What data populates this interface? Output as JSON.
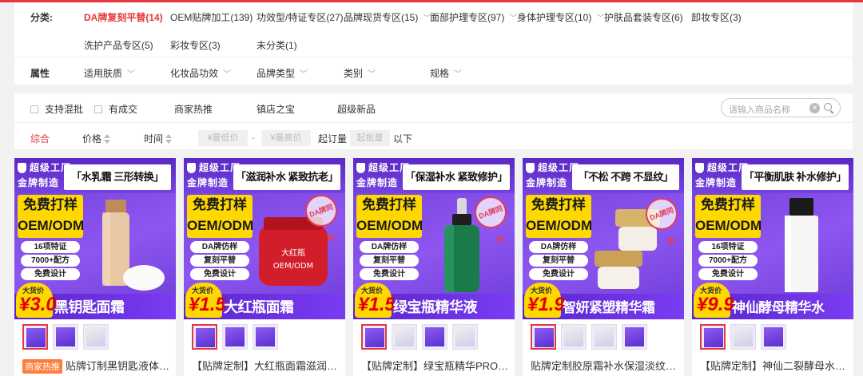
{
  "filters": {
    "category_label": "分类:",
    "categories": [
      {
        "label": "DA牌复刻平替(14)",
        "active": true
      },
      {
        "label": "OEM贴牌加工(139)"
      },
      {
        "label": "功效型/特证专区(27)"
      },
      {
        "label": "品牌现货专区(15)",
        "dropdown": true
      },
      {
        "label": "面部护理专区(97)",
        "dropdown": true
      },
      {
        "label": "身体护理专区(10)",
        "dropdown": true
      },
      {
        "label": "护肤品套装专区(6)"
      },
      {
        "label": "卸妆专区(3)"
      },
      {
        "label": "洗护产品专区(5)"
      },
      {
        "label": "彩妆专区(3)"
      },
      {
        "label": "未分类(1)"
      }
    ],
    "attr_label": "属性",
    "attributes": [
      "适用肤质",
      "化妆品功效",
      "品牌类型",
      "类别",
      "规格"
    ]
  },
  "sortbar": {
    "checkboxes": [
      "支持混批",
      "有成交"
    ],
    "tabs": [
      "商家热推",
      "镇店之宝",
      "超级新品"
    ],
    "search_placeholder": "请输入商品名称",
    "sort_options": [
      "综合",
      "价格",
      "时间"
    ],
    "price_min_placeholder": "¥最低价",
    "price_dash": "-",
    "price_max_placeholder": "¥最高价",
    "moq_label": "起订量",
    "moq_placeholder": "起批量",
    "moq_suffix": "以下"
  },
  "colors": {
    "accent": "#e4393c",
    "promo_purple": "#7a45e6",
    "promo_yellow": "#ffd800"
  },
  "products": [
    {
      "slogan": "「水乳霜 三形转换」",
      "factory": "超级工厂",
      "brand": "金牌制造",
      "free_sample": "免费打样",
      "oem": "OEM/ODM",
      "features": [
        "16项特证",
        "7000+配方",
        "免费设计"
      ],
      "price_label": "大货价",
      "price": "¥3.0",
      "name": "黑钥匙面霜",
      "seal": "",
      "tag": "商家热推",
      "title": "贴牌订制黑钥匙液体面霜",
      "thumbs": 3
    },
    {
      "slogan": "「滋润补水 紧致抗老」",
      "factory": "超级工厂",
      "brand": "金牌制造",
      "free_sample": "免费打样",
      "oem": "OEM/ODM",
      "features": [
        "DA牌仿样",
        "复刻平替",
        "免费设计"
      ],
      "price_label": "大货价",
      "price": "¥1.5",
      "name": "大红瓶面霜",
      "seal": "DA牌同款",
      "jar_text": "大红瓶\nOEM/ODM",
      "tag": "",
      "title": "【贴牌定制】大红瓶面霜滋润补水",
      "thumbs": 3
    },
    {
      "slogan": "「保湿补水 紧致修护」",
      "factory": "超级工厂",
      "brand": "金牌制造",
      "free_sample": "免费打样",
      "oem": "OEM/ODM",
      "features": [
        "DA牌仿样",
        "复刻平替",
        "免费设计"
      ],
      "price_label": "大货价",
      "price": "¥1.5",
      "name": "绿宝瓶精华液",
      "seal": "DA牌同款",
      "tag": "",
      "title": "【贴牌定制】绿宝瓶精华PRO补水",
      "thumbs": 4
    },
    {
      "slogan": "「不松 不跨 不显纹」",
      "factory": "超级工厂",
      "brand": "金牌制造",
      "free_sample": "免费打样",
      "oem": "OEM/ODM",
      "features": [
        "DA牌仿样",
        "复刻平替",
        "免费设计"
      ],
      "price_label": "大货价",
      "price": "¥1.9",
      "name": "智妍紧塑精华霜",
      "seal": "DA牌同款",
      "tag": "",
      "title": "贴牌定制胶原霜补水保湿淡纹抗皱",
      "thumbs": 4
    },
    {
      "slogan": "「平衡肌肤 补水修护」",
      "factory": "超级工厂",
      "brand": "金牌制造",
      "free_sample": "免费打样",
      "oem": "OEM/ODM",
      "features": [
        "16项特证",
        "7000+配方",
        "免费设计"
      ],
      "price_label": "大货价",
      "price": "¥9.9",
      "name": "神仙酵母精华水",
      "seal": "",
      "tag": "",
      "title": "【贴牌定制】神仙二裂酵母水平衡",
      "thumbs": 3
    }
  ]
}
